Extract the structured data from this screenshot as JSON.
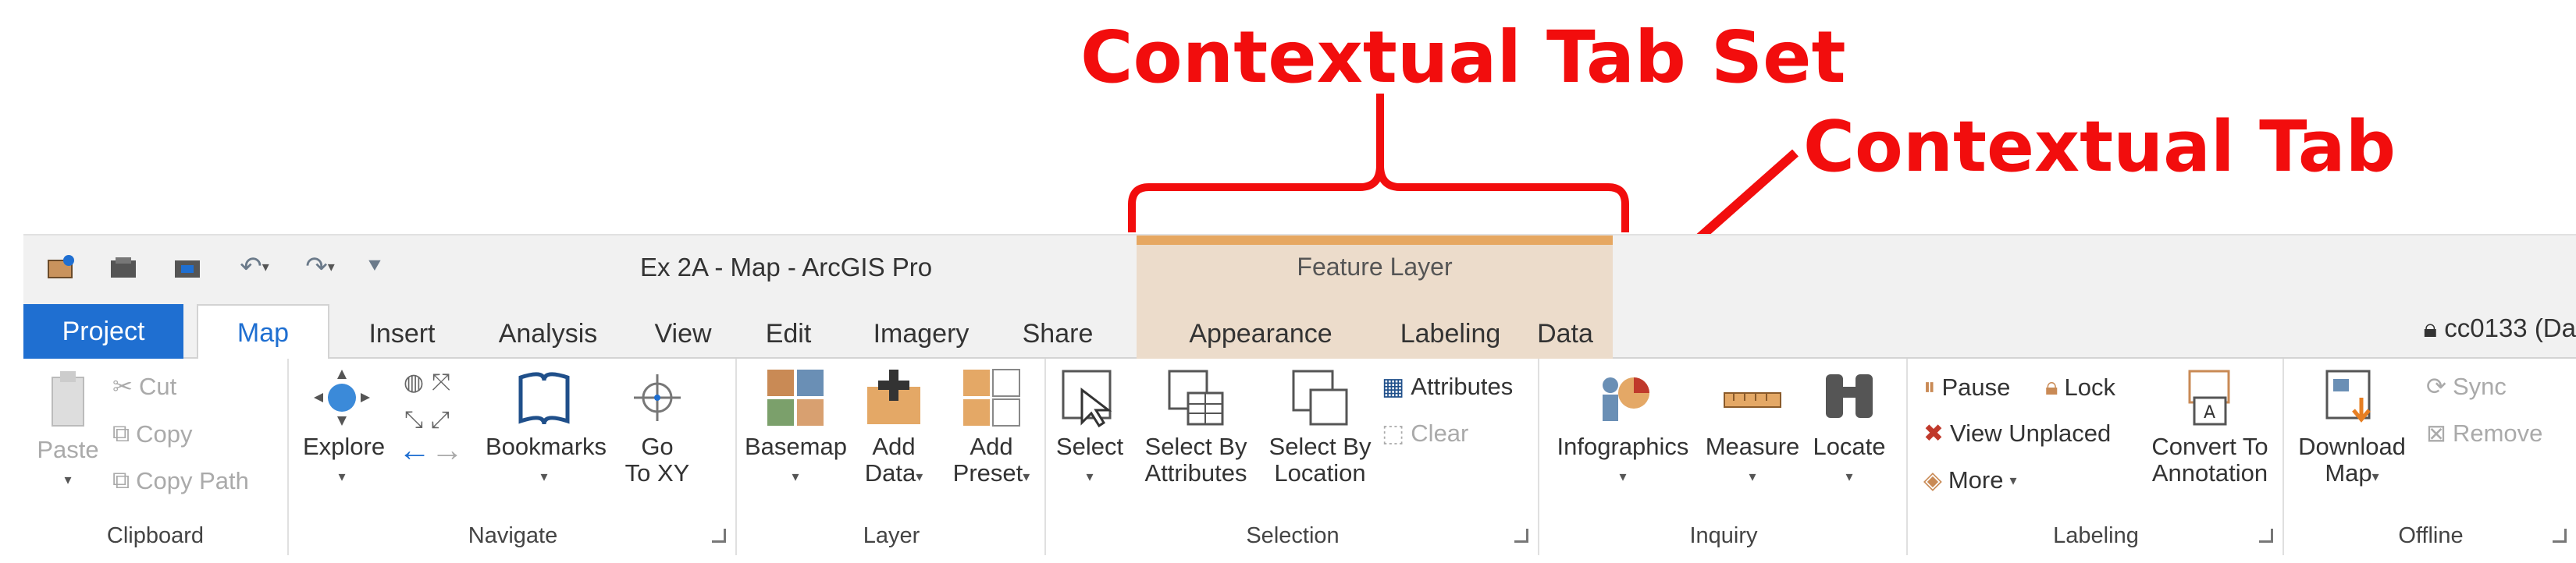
{
  "annotations": {
    "contextual_tab_set": "Contextual Tab Set",
    "contextual_tab": "Contextual Tab"
  },
  "window": {
    "title": "Ex 2A - Map - ArcGIS Pro",
    "context_title": "Feature Layer",
    "user": "cc0133 (Da"
  },
  "tabs": [
    "Project",
    "Map",
    "Insert",
    "Analysis",
    "View",
    "Edit",
    "Imagery",
    "Share",
    "Appearance",
    "Labeling",
    "Data"
  ],
  "groups": {
    "clipboard": {
      "label": "Clipboard",
      "paste": "Paste",
      "cut": "Cut",
      "copy": "Copy",
      "copy_path": "Copy Path"
    },
    "navigate": {
      "label": "Navigate",
      "explore": "Explore",
      "bookmarks": "Bookmarks",
      "go_to_xy_1": "Go",
      "go_to_xy_2": "To XY"
    },
    "layer": {
      "label": "Layer",
      "basemap": "Basemap",
      "add_data_1": "Add",
      "add_data_2": "Data",
      "add_preset_1": "Add",
      "add_preset_2": "Preset"
    },
    "selection": {
      "label": "Selection",
      "select": "Select",
      "by_attr_1": "Select By",
      "by_attr_2": "Attributes",
      "by_loc_1": "Select By",
      "by_loc_2": "Location",
      "attributes": "Attributes",
      "clear": "Clear"
    },
    "inquiry": {
      "label": "Inquiry",
      "infographics": "Infographics",
      "measure": "Measure",
      "locate": "Locate"
    },
    "labeling": {
      "label": "Labeling",
      "pause": "Pause",
      "lock": "Lock",
      "view_unplaced": "View Unplaced",
      "more": "More",
      "convert_1": "Convert To",
      "convert_2": "Annotation"
    },
    "offline": {
      "label": "Offline",
      "download_1": "Download",
      "download_2": "Map",
      "sync": "Sync",
      "remove": "Remove"
    }
  },
  "colors": {
    "annotation": "#f20d0d",
    "project_tab": "#1f6fd1",
    "contextual_bg": "#ecdccb",
    "contextual_bar": "#e6a761"
  }
}
